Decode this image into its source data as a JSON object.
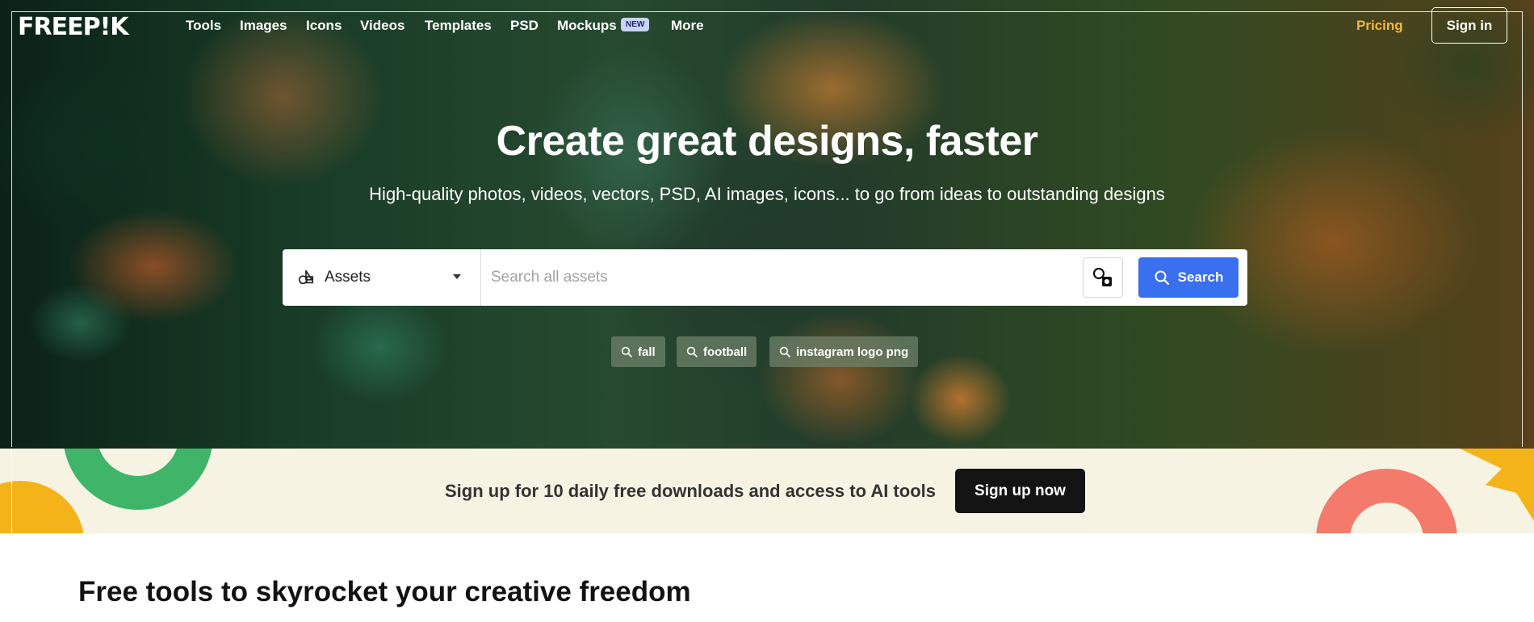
{
  "nav": {
    "logo": "FREEP!K",
    "items": [
      "Tools",
      "Images",
      "Icons",
      "Videos",
      "Templates",
      "PSD",
      "Mockups",
      "More"
    ],
    "new_badge": "NEW",
    "pricing": "Pricing",
    "signin": "Sign in"
  },
  "hero": {
    "title": "Create great designs, faster",
    "subtitle": "High-quality photos, videos, vectors, PSD, AI images, icons... to go from ideas to outstanding designs"
  },
  "search": {
    "asset_type": "Assets",
    "placeholder": "Search all assets",
    "button": "Search"
  },
  "tags": [
    "fall",
    "football",
    "instagram logo png"
  ],
  "banner": {
    "text": "Sign up for 10 daily free downloads and access to AI tools",
    "button": "Sign up now"
  },
  "section": {
    "title": "Free tools to skyrocket your creative freedom"
  },
  "colors": {
    "accent_blue": "#3a6ff0",
    "pricing_gold": "#f5b73a",
    "banner_bg": "#f7f3e3"
  }
}
